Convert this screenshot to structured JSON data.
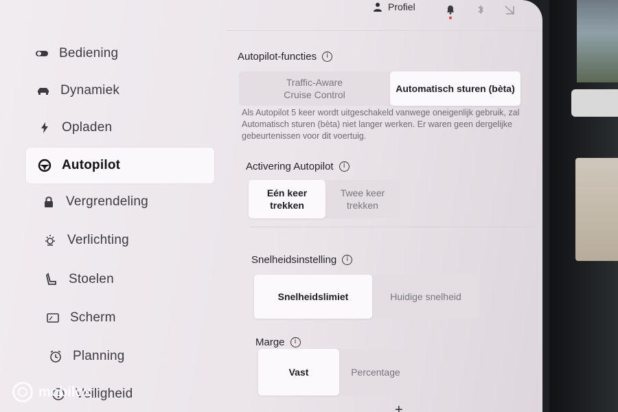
{
  "topbar": {
    "profile_label": "Profiel",
    "icons": [
      "person-icon",
      "bell-icon",
      "bluetooth-icon",
      "signal-icon"
    ]
  },
  "sidebar": {
    "items": [
      {
        "label": "Bediening",
        "icon": "toggle-icon"
      },
      {
        "label": "Dynamiek",
        "icon": "car-icon"
      },
      {
        "label": "Opladen",
        "icon": "lightning-icon"
      },
      {
        "label": "Autopilot",
        "icon": "steering-wheel-icon",
        "active": true
      },
      {
        "label": "Vergrendeling",
        "icon": "lock-icon"
      },
      {
        "label": "Verlichting",
        "icon": "light-icon"
      },
      {
        "label": "Stoelen",
        "icon": "seat-icon"
      },
      {
        "label": "Scherm",
        "icon": "screen-icon"
      },
      {
        "label": "Planning",
        "icon": "clock-icon"
      },
      {
        "label": "Veiligheid",
        "icon": "safety-icon"
      }
    ]
  },
  "autopilot_functies": {
    "title": "Autopilot-functies",
    "options": [
      "Traffic-Aware\nCruise Control",
      "Automatisch sturen (bèta)"
    ],
    "selected": "Automatisch sturen (bèta)",
    "description": "Als Autopilot 5 keer wordt uitgeschakeld vanwege oneigenlijk gebruik, zal Automatisch sturen (bèta) niet langer werken. Er waren geen dergelijke gebeurtenissen voor dit voertuig."
  },
  "activering": {
    "title": "Activering Autopilot",
    "options": [
      "Eén keer\ntrekken",
      "Twee keer\ntrekken"
    ],
    "selected": "Eén keer\ntrekken"
  },
  "snelheid": {
    "title": "Snelheidsinstelling",
    "options": [
      "Snelheidslimiet",
      "Huidige snelheid"
    ],
    "selected": "Snelheidslimiet"
  },
  "marge": {
    "title": "Marge",
    "options": [
      "Vast",
      "Percentage"
    ],
    "selected": "Vast"
  },
  "watermark": "mobilox",
  "colors": {
    "screen_bg": "#ece6eb",
    "selected_bg": "#fbf9fb",
    "text": "#1f1f24",
    "muted": "#77757c",
    "notification_dot": "#e0403a"
  }
}
